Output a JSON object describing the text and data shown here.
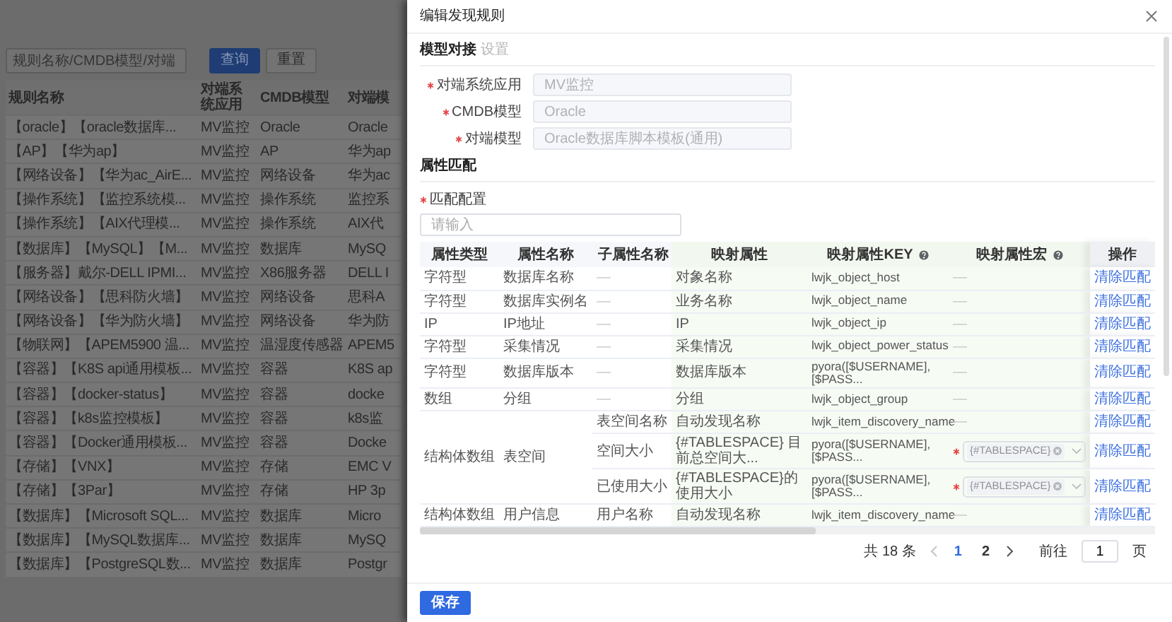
{
  "background_page": {
    "search": {
      "placeholder": "规则名称/CMDB模型/对端"
    },
    "buttons": [
      {
        "label": "查询",
        "kind": "primary"
      },
      {
        "label": "重置",
        "kind": "default"
      }
    ],
    "table": {
      "columns": [
        "规则名称",
        "对端系统应用",
        "CMDB模型",
        "对端模"
      ],
      "rows": [
        [
          "【oracle】【oracle数据库...",
          "MV监控",
          "Oracle",
          "Oracle"
        ],
        [
          "【AP】【华为ap】",
          "MV监控",
          "AP",
          "华为ap"
        ],
        [
          "【网络设备】【华为ac_AirE...",
          "MV监控",
          "网络设备",
          "华为ac"
        ],
        [
          "【操作系统】【监控系统模...",
          "MV监控",
          "操作系统",
          "监控系"
        ],
        [
          "【操作系统】【AIX代理模...",
          "MV监控",
          "操作系统",
          "AIX代"
        ],
        [
          "【数据库】【MySQL】【M...",
          "MV监控",
          "数据库",
          "MySQ"
        ],
        [
          "【服务器】戴尔-DELL IPMI...",
          "MV监控",
          "X86服务器",
          "DELL I"
        ],
        [
          "【网络设备】【思科防火墙】",
          "MV监控",
          "网络设备",
          "思科A"
        ],
        [
          "【网络设备】【华为防火墙】",
          "MV监控",
          "网络设备",
          "华为防"
        ],
        [
          "【物联网】【APEM5900 温...",
          "MV监控",
          "温湿度传感器",
          "APEM5"
        ],
        [
          "【容器】【K8S api通用模板...",
          "MV监控",
          "容器",
          "K8S ap"
        ],
        [
          "【容器】【docker-status】",
          "MV监控",
          "容器",
          "docke"
        ],
        [
          "【容器】【k8s监控模板】",
          "MV监控",
          "容器",
          "k8s监"
        ],
        [
          "【容器】【Docker通用模板...",
          "MV监控",
          "容器",
          "Docke"
        ],
        [
          "【存储】【VNX】",
          "MV监控",
          "存储",
          "EMC V"
        ],
        [
          "【存储】【3Par】",
          "MV监控",
          "存储",
          "HP 3p"
        ],
        [
          "【数据库】【Microsoft SQL...",
          "MV监控",
          "数据库",
          "Micro"
        ],
        [
          "【数据库】【MySQL数据库...",
          "MV监控",
          "数据库",
          "MySQ"
        ],
        [
          "【数据库】【PostgreSQL数...",
          "MV监控",
          "数据库",
          "Postgr"
        ]
      ]
    }
  },
  "drawer": {
    "title": "编辑发现规则",
    "model_section": {
      "title": "模型对接",
      "hint": "设置",
      "fields": [
        {
          "label": "对端系统应用",
          "required": true,
          "value": "MV监控",
          "disabled": true
        },
        {
          "label": "CMDB模型",
          "required": true,
          "value": "Oracle",
          "disabled": true
        },
        {
          "label": "对端模型",
          "required": true,
          "value": "Oracle数据库脚本模板(通用)",
          "disabled": true
        }
      ]
    },
    "attribute_section": {
      "title": "属性匹配",
      "match_label": "匹配配置",
      "match_required": true,
      "search": {
        "placeholder": "请输入"
      },
      "table": {
        "columns": [
          {
            "label": "属性类型",
            "help": false
          },
          {
            "label": "属性名称",
            "help": false
          },
          {
            "label": "子属性名称",
            "help": false
          },
          {
            "label": "映射属性",
            "help": false
          },
          {
            "label": "映射属性KEY",
            "help": true
          },
          {
            "label": "映射属性宏",
            "help": true
          },
          {
            "label": "操作",
            "help": false
          }
        ],
        "rows": [
          {
            "type": "字符型",
            "name": "数据库名称",
            "children": [
              {
                "sub": "—",
                "attr": "对象名称",
                "key": "lwjk_object_host",
                "macro": {
                  "kind": "text",
                  "text": "—"
                },
                "action": "清除匹配"
              }
            ]
          },
          {
            "type": "字符型",
            "name": "数据库实例名",
            "children": [
              {
                "sub": "—",
                "attr": "业务名称",
                "key": "lwjk_object_name",
                "macro": {
                  "kind": "text",
                  "text": "—"
                },
                "action": "清除匹配"
              }
            ]
          },
          {
            "type": "IP",
            "name": "IP地址",
            "children": [
              {
                "sub": "—",
                "attr": "IP",
                "key": "lwjk_object_ip",
                "macro": {
                  "kind": "text",
                  "text": "—"
                },
                "action": "清除匹配"
              }
            ]
          },
          {
            "type": "字符型",
            "name": "采集情况",
            "children": [
              {
                "sub": "—",
                "attr": "采集情况",
                "key": "lwjk_object_power_status",
                "macro": {
                  "kind": "text",
                  "text": "—"
                },
                "action": "清除匹配"
              }
            ]
          },
          {
            "type": "字符型",
            "name": "数据库版本",
            "children": [
              {
                "sub": "—",
                "attr": "数据库版本",
                "key": "pyora([$USERNAME],[$PASS...",
                "macro": {
                  "kind": "text",
                  "text": "—"
                },
                "action": "清除匹配"
              }
            ]
          },
          {
            "type": "数组",
            "name": "分组",
            "children": [
              {
                "sub": "—",
                "attr": "分组",
                "key": "lwjk_object_group",
                "macro": {
                  "kind": "text",
                  "text": "—"
                },
                "action": "清除匹配"
              }
            ]
          },
          {
            "type": "结构体数组",
            "name": "表空间",
            "children": [
              {
                "sub": "表空间名称",
                "attr": "自动发现名称",
                "key": "lwjk_item_discovery_name",
                "macro": {
                  "kind": "text",
                  "text": "—"
                },
                "action": "清除匹配"
              },
              {
                "sub": "空间大小",
                "attr": "{#TABLESPACE} 目前总空间大...",
                "key": "pyora([$USERNAME],[$PASS...",
                "macro": {
                  "kind": "select",
                  "required": true,
                  "tag": "{#TABLESPACE}"
                },
                "action": "清除匹配"
              },
              {
                "sub": "已使用大小",
                "attr": "{#TABLESPACE}的使用大小",
                "key": "pyora([$USERNAME],[$PASS...",
                "macro": {
                  "kind": "select",
                  "required": true,
                  "tag": "{#TABLESPACE}"
                },
                "action": "清除匹配"
              }
            ]
          },
          {
            "type": "结构体数组",
            "name": "用户信息",
            "children": [
              {
                "sub": "用户名称",
                "attr": "自动发现名称",
                "key": "lwjk_item_discovery_name",
                "macro": {
                  "kind": "text",
                  "text": "—"
                },
                "action": "清除匹配"
              }
            ]
          }
        ]
      },
      "pagination": {
        "total": "共 18 条",
        "pages": [
          {
            "label": "1",
            "selected": true
          },
          {
            "label": "2",
            "selected": false
          }
        ],
        "goto_label": "前往",
        "goto_value": "1",
        "page_unit": "页"
      }
    },
    "save_button": "保存"
  }
}
